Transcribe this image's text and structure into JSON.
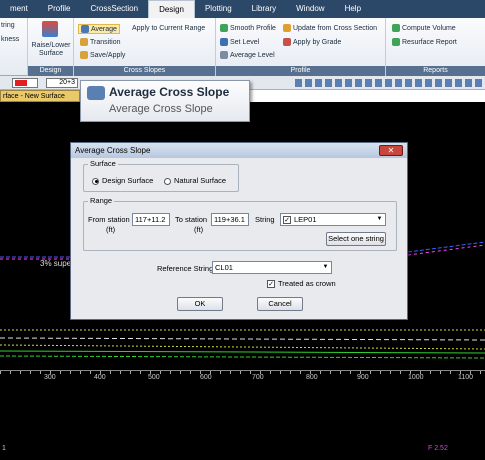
{
  "menu": {
    "items": [
      "ment",
      "Profile",
      "CrossSection",
      "Design",
      "Plotting",
      "Library",
      "Window",
      "Help"
    ],
    "active": "Design"
  },
  "ribbon": {
    "edit_btn1": "tring",
    "edit_btn2": "kness",
    "raise_lower": "Raise/Lower Surface",
    "group_design": "Design",
    "average": "Average",
    "apply_current": "Apply to Current Range",
    "transition": "Transition",
    "save_apply": "Save/Apply",
    "group_cross": "Cross Slopes",
    "smooth_profile": "Smooth Profile",
    "update_cross": "Update from Cross Section",
    "set_level": "Set Level",
    "apply_grade": "Apply by Grade",
    "average_level": "Average Level",
    "group_profile": "Profile",
    "compute_volume": "Compute Volume",
    "resurface_report": "Resurface Report",
    "group_reports": "Reports"
  },
  "toolbar": {
    "station": "20+3",
    "surface_tab": "rface - New Surface"
  },
  "tooltip": {
    "title": "Average Cross Slope",
    "desc": "Average Cross Slope"
  },
  "dialog": {
    "title": "Average Cross Slope",
    "close": "✕",
    "surface_legend": "Surface",
    "design_surface": "Design Surface",
    "natural_surface": "Natural Surface",
    "range_legend": "Range",
    "from_station_label": "From station",
    "from_station_unit": "(ft)",
    "from_station_value": "117+11.2",
    "to_station_label": "To station",
    "to_station_unit": "(ft)",
    "to_station_value": "119+36.1",
    "string_label": "String",
    "string_value": "LEP01",
    "select_one_string": "Select one string",
    "reference_string_label": "Reference String",
    "reference_string_value": "CL01",
    "treated_as_crown": "Treated as crown",
    "ok": "OK",
    "cancel": "Cancel"
  },
  "canvas": {
    "superelev": "3% supe",
    "ruler_labels": [
      "300",
      "400",
      "500",
      "600",
      "700",
      "800",
      "900",
      "1000",
      "1100"
    ],
    "status_left": "1",
    "status_right": "F 2.52"
  }
}
